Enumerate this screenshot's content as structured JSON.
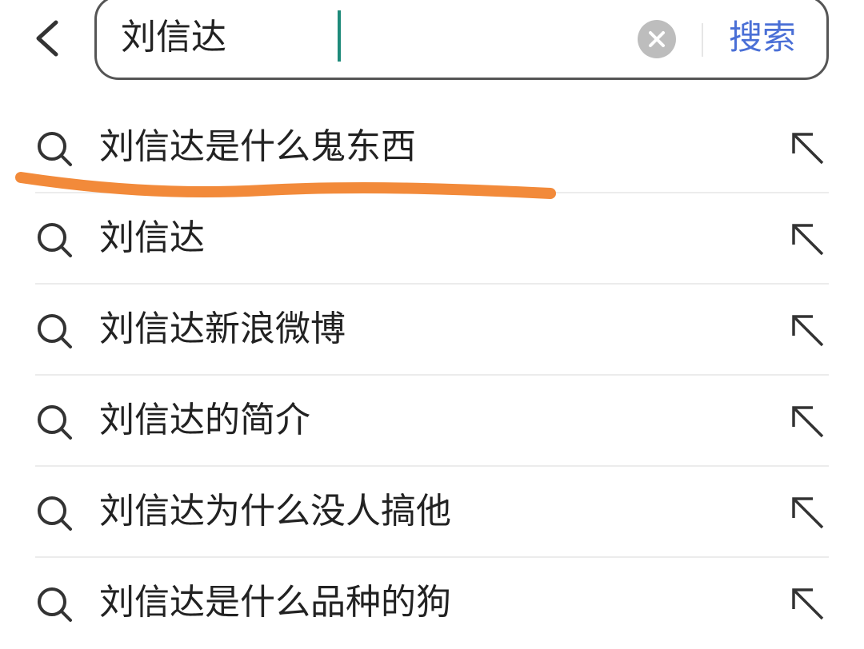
{
  "search": {
    "value": "刘信达",
    "action_label": "搜索"
  },
  "suggestions": [
    {
      "label": "刘信达是什么鬼东西"
    },
    {
      "label": "刘信达"
    },
    {
      "label": "刘信达新浪微博"
    },
    {
      "label": "刘信达的简介"
    },
    {
      "label": "刘信达为什么没人搞他"
    },
    {
      "label": "刘信达是什么品种的狗"
    }
  ],
  "colors": {
    "accent": "#4a6fd6",
    "caret": "#1e8a7a",
    "highlight_stroke": "#f28a3a"
  }
}
